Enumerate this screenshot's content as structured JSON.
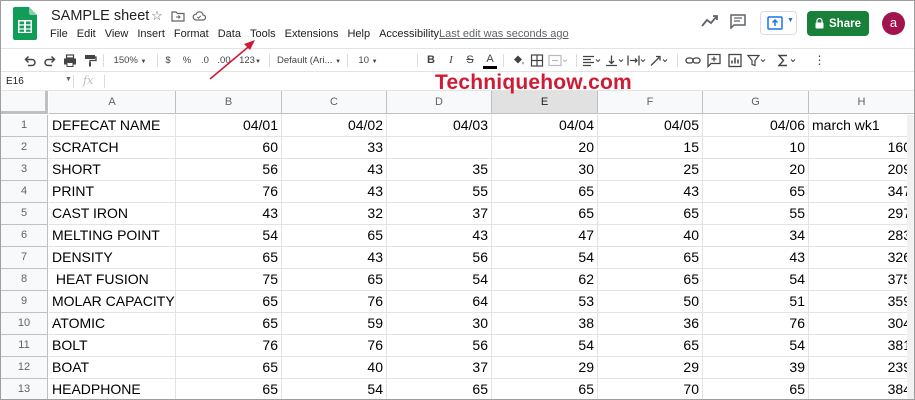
{
  "document": {
    "title": "SAMPLE sheet",
    "last_edit": "Last edit was seconds ago"
  },
  "menu": [
    "File",
    "Edit",
    "View",
    "Insert",
    "Format",
    "Data",
    "Tools",
    "Extensions",
    "Help",
    "Accessibility"
  ],
  "header_actions": {
    "share_label": "Share",
    "avatar_letter": "a"
  },
  "toolbar": {
    "zoom": "150%",
    "currency": "$",
    "percent": "%",
    "decrease_decimal": ".0",
    "increase_decimal": ".00",
    "more_formats": "123",
    "font": "Default (Ari...",
    "font_size": "10",
    "bold": "B",
    "italic": "I",
    "strikethrough": "S",
    "text_color": "A"
  },
  "formula_bar": {
    "cell_ref": "E16",
    "fx": "fx"
  },
  "watermark": "Techniquehow.com",
  "grid": {
    "columns": [
      "A",
      "B",
      "C",
      "D",
      "E",
      "F",
      "G",
      "H"
    ],
    "selected_column": "E",
    "rows": [
      {
        "n": "1",
        "cells": [
          "DEFECAT NAME",
          "04/01",
          "04/02",
          "04/03",
          "04/04",
          "04/05",
          "04/06",
          "march wk1"
        ]
      },
      {
        "n": "2",
        "cells": [
          "SCRATCH",
          "60",
          "33",
          "",
          "20",
          "15",
          "10",
          "160"
        ]
      },
      {
        "n": "3",
        "cells": [
          "SHORT",
          "56",
          "43",
          "35",
          "30",
          "25",
          "20",
          "209"
        ]
      },
      {
        "n": "4",
        "cells": [
          "PRINT",
          "76",
          "43",
          "55",
          "65",
          "43",
          "65",
          "347"
        ]
      },
      {
        "n": "5",
        "cells": [
          "CAST IRON",
          "43",
          "32",
          "37",
          "65",
          "65",
          "55",
          "297"
        ]
      },
      {
        "n": "6",
        "cells": [
          "MELTING POINT",
          "54",
          "65",
          "43",
          "47",
          "40",
          "34",
          "283"
        ]
      },
      {
        "n": "7",
        "cells": [
          "DENSITY",
          "65",
          "43",
          "56",
          "54",
          "65",
          "43",
          "326"
        ]
      },
      {
        "n": "8",
        "cells": [
          " HEAT FUSION",
          "75",
          "65",
          "54",
          "62",
          "65",
          "54",
          "375"
        ]
      },
      {
        "n": "9",
        "cells": [
          "MOLAR CAPACITY",
          "65",
          "76",
          "64",
          "53",
          "50",
          "51",
          "359"
        ]
      },
      {
        "n": "10",
        "cells": [
          "ATOMIC",
          "65",
          "59",
          "30",
          "38",
          "36",
          "76",
          "304"
        ]
      },
      {
        "n": "11",
        "cells": [
          "BOLT",
          "76",
          "76",
          "56",
          "54",
          "65",
          "54",
          "381"
        ]
      },
      {
        "n": "12",
        "cells": [
          "BOAT",
          "65",
          "40",
          "37",
          "29",
          "29",
          "39",
          "239"
        ]
      },
      {
        "n": "13",
        "cells": [
          "HEADPHONE",
          "65",
          "54",
          "65",
          "65",
          "70",
          "65",
          "384"
        ]
      }
    ]
  },
  "colors": {
    "share_green": "#188038",
    "avatar": "#a3134d",
    "watermark_red": "#d11b35",
    "sheets_green": "#0f9d58"
  }
}
